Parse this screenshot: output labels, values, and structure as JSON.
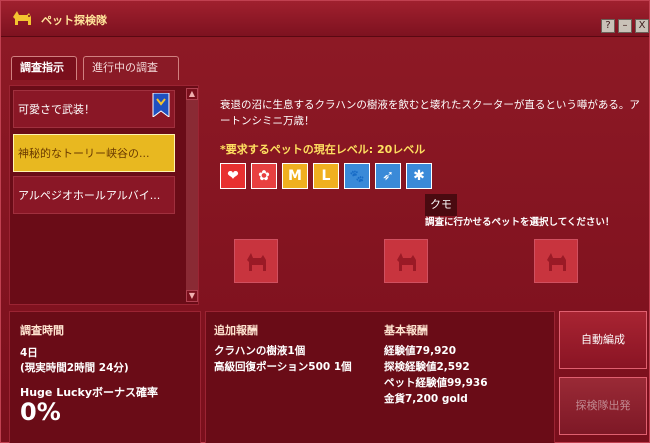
{
  "window": {
    "title": "ペット探検隊",
    "buttons": [
      "?",
      "–",
      "X"
    ]
  },
  "tabs": [
    {
      "label": "調査指示",
      "active": true
    },
    {
      "label": "進行中の調査",
      "active": false
    }
  ],
  "list": {
    "items": [
      {
        "label": "可愛さで武装！",
        "badge": true
      },
      {
        "label": "神秘的なトーリー峡谷の...",
        "selected": true
      },
      {
        "label": "アルペジオホールアルバイ..."
      }
    ]
  },
  "detail": {
    "description": "衰退の沼に生息するクラハンの樹液を飲むと壊れたスクーターが直るという噂がある。アートンシミニ万歳！",
    "requirement": "*要求するペットの現在レベル: 20レベル",
    "skills": [
      {
        "icon": "heart-icon",
        "glyph": "❤",
        "color": "#e83030"
      },
      {
        "icon": "gear-icon",
        "glyph": "✿",
        "color": "#e84040"
      },
      {
        "icon": "m-icon",
        "glyph": "M",
        "color": "#f0b020"
      },
      {
        "icon": "l-icon",
        "glyph": "L",
        "color": "#f0b020"
      },
      {
        "icon": "paw-icon",
        "glyph": "🐾",
        "color": "#3a8ad8"
      },
      {
        "icon": "wing-icon",
        "glyph": "➶",
        "color": "#3a8ad8"
      },
      {
        "icon": "spider-icon",
        "glyph": "✱",
        "color": "#3a8ad8"
      }
    ],
    "tooltip": "クモ",
    "select_message": "調査に行かせるペットを選択してください！"
  },
  "bottom": {
    "time_title": "調査時間",
    "time_value": "4日",
    "time_real": "(現実時間2時間 24分)",
    "lucky_title": "Huge Luckyボーナス確率",
    "lucky_value": "0%",
    "extra_title": "追加報酬",
    "extra_items": [
      "クラハンの樹液1個",
      "高級回復ポーション500 1個"
    ],
    "base_title": "基本報酬",
    "base_items": [
      "経験値79,920",
      "探検経験値2,592",
      "ペット経験値99,936",
      "金貨7,200 gold"
    ],
    "auto_button": "自動編成",
    "dispatch_button": "探検隊出発"
  }
}
